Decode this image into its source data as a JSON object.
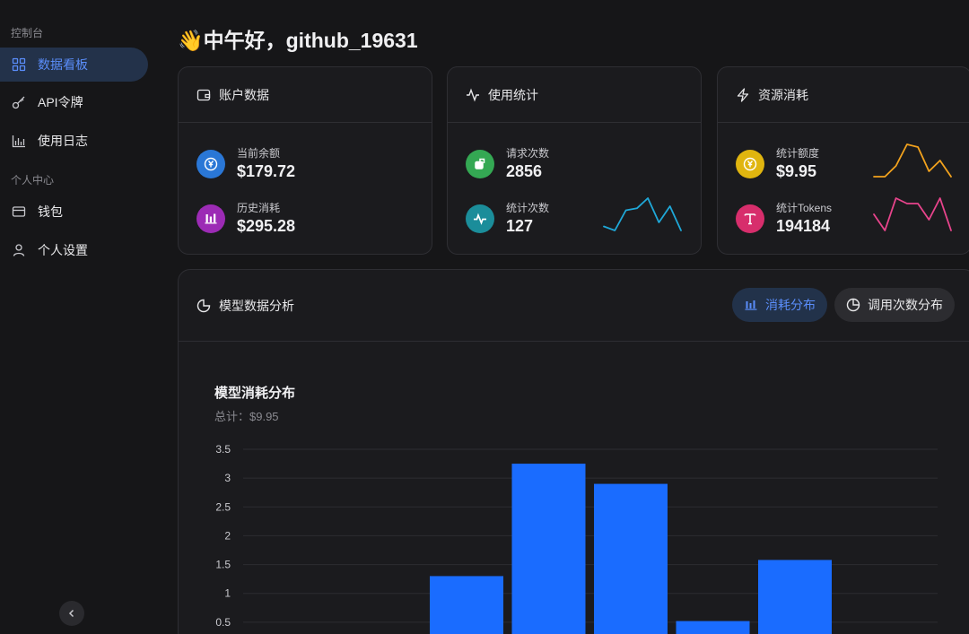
{
  "sidebar": {
    "sections": [
      {
        "title": "控制台"
      },
      {
        "title": "个人中心"
      }
    ],
    "items": [
      {
        "label": "数据看板",
        "icon": "dashboard-icon",
        "active": true
      },
      {
        "label": "API令牌",
        "icon": "key-icon"
      },
      {
        "label": "使用日志",
        "icon": "chart-bar-icon"
      },
      {
        "label": "钱包",
        "icon": "wallet-icon"
      },
      {
        "label": "个人设置",
        "icon": "user-icon"
      }
    ]
  },
  "greeting": "👋中午好，github_19631",
  "cards": {
    "account": {
      "title": "账户数据",
      "balance_label": "当前余额",
      "balance_value": "$179.72",
      "history_label": "历史消耗",
      "history_value": "$295.28"
    },
    "usage": {
      "title": "使用统计",
      "requests_label": "请求次数",
      "requests_value": "2856",
      "stat_count_label": "统计次数",
      "stat_count_value": "127"
    },
    "resource": {
      "title": "资源消耗",
      "quota_label": "统计额度",
      "quota_value": "$9.95",
      "tokens_label": "统计Tokens",
      "tokens_value": "194184"
    }
  },
  "sparklines": {
    "stat_count": [
      2,
      1,
      6,
      6.5,
      9,
      3,
      7,
      1
    ],
    "quota": [
      1,
      1,
      3,
      7,
      6.5,
      2,
      4,
      1
    ],
    "tokens": [
      4,
      1,
      7,
      6,
      6,
      3,
      7,
      1
    ]
  },
  "colors": {
    "accent": "#5a8dfa",
    "bar": "#1a6cff",
    "balance_icon": "#2a77d6",
    "history_icon": "#9c2bb5",
    "requests_icon": "#34a853",
    "stat_count_icon": "#1b8d9a",
    "quota_icon": "#e0b50f",
    "tokens_icon": "#d72e6c",
    "spark_blue": "#1fa8d8",
    "spark_orange": "#f2a21d",
    "spark_pink": "#e8448c"
  },
  "analysis": {
    "title": "模型数据分析",
    "tabs": [
      {
        "label": "消耗分布",
        "active": true
      },
      {
        "label": "调用次数分布",
        "active": false
      }
    ]
  },
  "chart_data": {
    "type": "bar",
    "title": "模型消耗分布",
    "subtitle": "总计：$9.95",
    "ylim": [
      0,
      3.5
    ],
    "yticks": [
      "3.5",
      "3",
      "2.5",
      "2",
      "1.5",
      "1",
      "0.5"
    ],
    "values": [
      0,
      0,
      1.3,
      3.25,
      2.9,
      0.52,
      1.58
    ],
    "grid": true
  }
}
